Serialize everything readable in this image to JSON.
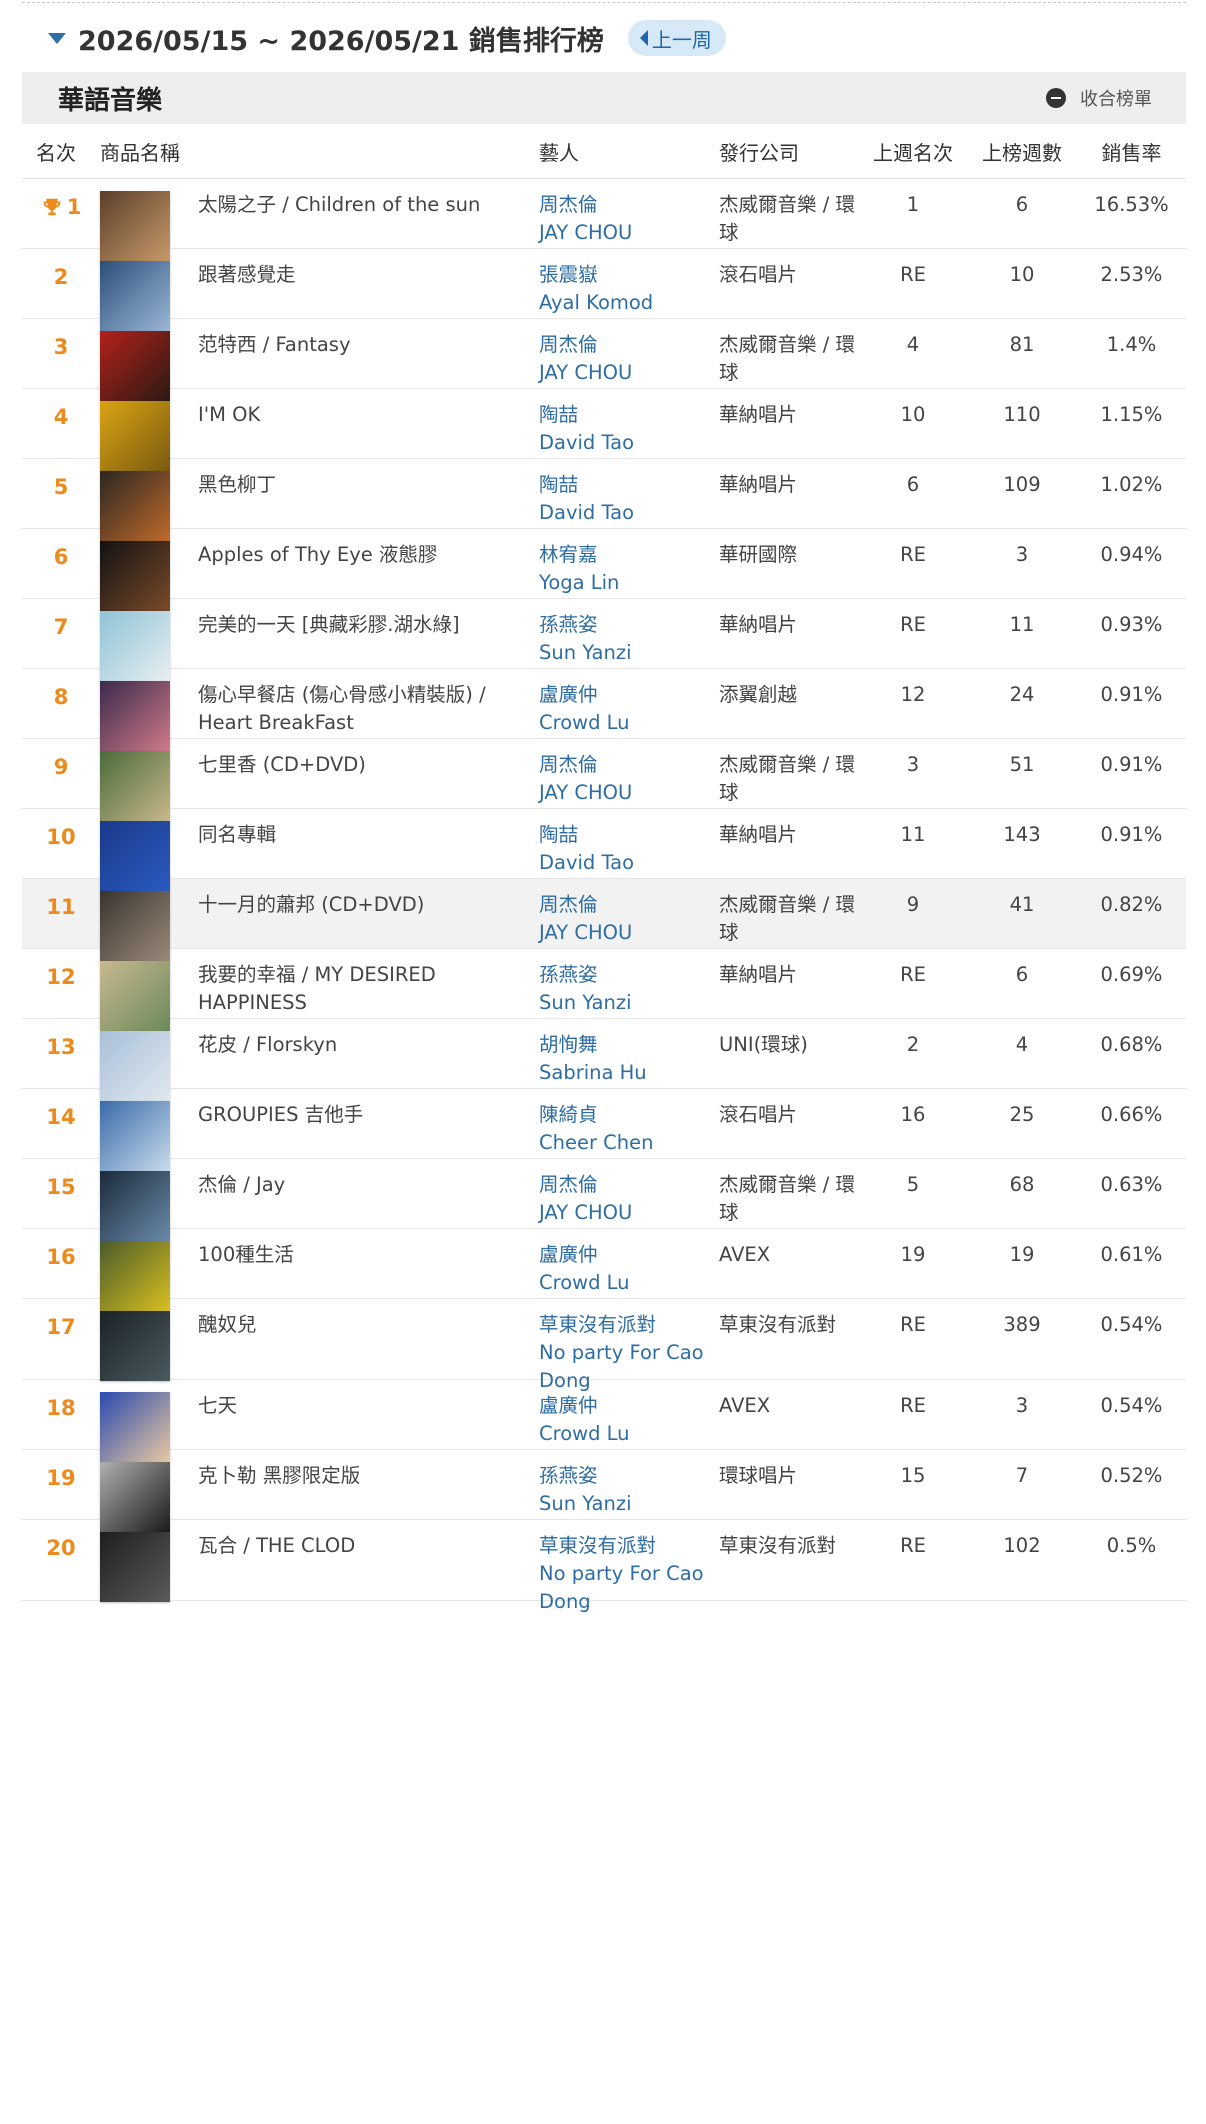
{
  "week": {
    "title": "2026/05/15 ~ 2026/05/21 銷售排行榜",
    "prev_label": "上一周"
  },
  "section": {
    "title": "華語音樂",
    "collapse_label": "收合榜單"
  },
  "columns": {
    "rank": "名次",
    "product": "商品名稱",
    "artist": "藝人",
    "label": "發行公司",
    "last_week": "上週名次",
    "weeks_on_chart": "上榜週數",
    "sales_rate": "銷售率"
  },
  "colors": {
    "accent_rank": "#ec8a1c",
    "link_blue": "#2e6da4"
  },
  "rows": [
    {
      "rank": "1",
      "trophy": true,
      "title": "太陽之子 / Children of the sun",
      "artist_zh": "周杰倫",
      "artist_en": "JAY CHOU",
      "label": "杰威爾音樂 / 環球",
      "last": "1",
      "weeks": "6",
      "rate": "16.53%",
      "cover": [
        "#5a3e2a",
        "#c89a6a"
      ]
    },
    {
      "rank": "2",
      "title": "跟著感覺走",
      "artist_zh": "張震嶽",
      "artist_en": "Ayal Komod",
      "label": "滾石唱片",
      "last": "RE",
      "weeks": "10",
      "rate": "2.53%",
      "cover": [
        "#2a4f7a",
        "#9bb7d6"
      ]
    },
    {
      "rank": "3",
      "title": "范特西 / Fantasy",
      "artist_zh": "周杰倫",
      "artist_en": "JAY CHOU",
      "label": "杰威爾音樂 / 環球",
      "last": "4",
      "weeks": "81",
      "rate": "1.4%",
      "cover": [
        "#b3201a",
        "#2a1a14"
      ]
    },
    {
      "rank": "4",
      "title": "I'M OK",
      "artist_zh": "陶喆",
      "artist_en": "David Tao",
      "label": "華納唱片",
      "last": "10",
      "weeks": "110",
      "rate": "1.15%",
      "cover": [
        "#d9a413",
        "#7a5a10"
      ]
    },
    {
      "rank": "5",
      "title": "黑色柳丁",
      "artist_zh": "陶喆",
      "artist_en": "David Tao",
      "label": "華納唱片",
      "last": "6",
      "weeks": "109",
      "rate": "1.02%",
      "cover": [
        "#2a2622",
        "#c06a2a"
      ]
    },
    {
      "rank": "6",
      "title": "Apples of Thy Eye 液態膠",
      "artist_zh": "林宥嘉",
      "artist_en": "Yoga Lin",
      "label": "華研國際",
      "last": "RE",
      "weeks": "3",
      "rate": "0.94%",
      "cover": [
        "#111111",
        "#7a4a2a"
      ]
    },
    {
      "rank": "7",
      "title": "完美的一天 [典藏彩膠.湖水綠]",
      "artist_zh": "孫燕姿",
      "artist_en": "Sun Yanzi",
      "label": "華納唱片",
      "last": "RE",
      "weeks": "11",
      "rate": "0.93%",
      "cover": [
        "#8ec3d6",
        "#e8eef0"
      ]
    },
    {
      "rank": "8",
      "title": "傷心早餐店 (傷心骨感小精裝版) / Heart BreakFast",
      "artist_zh": "盧廣仲",
      "artist_en": "Crowd Lu",
      "label": "添翼創越",
      "last": "12",
      "weeks": "24",
      "rate": "0.91%",
      "cover": [
        "#3a2a4a",
        "#d07a8a"
      ]
    },
    {
      "rank": "9",
      "title": "七里香 (CD+DVD)",
      "artist_zh": "周杰倫",
      "artist_en": "JAY CHOU",
      "label": "杰威爾音樂 / 環球",
      "last": "3",
      "weeks": "51",
      "rate": "0.91%",
      "cover": [
        "#4a6a3a",
        "#c8b88a"
      ]
    },
    {
      "rank": "10",
      "title": "同名專輯",
      "artist_zh": "陶喆",
      "artist_en": "David Tao",
      "label": "華納唱片",
      "last": "11",
      "weeks": "143",
      "rate": "0.91%",
      "cover": [
        "#1a3a8a",
        "#2a5ac0"
      ]
    },
    {
      "rank": "11",
      "highlight": true,
      "title": "十一月的蕭邦 (CD+DVD)",
      "artist_zh": "周杰倫",
      "artist_en": "JAY CHOU",
      "label": "杰威爾音樂 / 環球",
      "last": "9",
      "weeks": "41",
      "rate": "0.82%",
      "cover": [
        "#3a342e",
        "#9a8a7a"
      ]
    },
    {
      "rank": "12",
      "title": "我要的幸福 / MY DESIRED HAPPINESS",
      "artist_zh": "孫燕姿",
      "artist_en": "Sun Yanzi",
      "label": "華納唱片",
      "last": "RE",
      "weeks": "6",
      "rate": "0.69%",
      "cover": [
        "#c8b890",
        "#6a8a5a"
      ]
    },
    {
      "rank": "13",
      "title": "花皮 / Florskyn",
      "artist_zh": "胡恂舞",
      "artist_en": "Sabrina Hu",
      "label": "UNI(環球)",
      "last": "2",
      "weeks": "4",
      "rate": "0.68%",
      "cover": [
        "#a8c0d8",
        "#e0e8f0"
      ]
    },
    {
      "rank": "14",
      "title": "GROUPIES 吉他手",
      "artist_zh": "陳綺貞",
      "artist_en": "Cheer Chen",
      "label": "滾石唱片",
      "last": "16",
      "weeks": "25",
      "rate": "0.66%",
      "cover": [
        "#3a6aa8",
        "#c8dcec"
      ]
    },
    {
      "rank": "15",
      "title": "杰倫 / Jay",
      "artist_zh": "周杰倫",
      "artist_en": "JAY CHOU",
      "label": "杰威爾音樂 / 環球",
      "last": "5",
      "weeks": "68",
      "rate": "0.63%",
      "cover": [
        "#1a2a3a",
        "#6a8aaa"
      ]
    },
    {
      "rank": "16",
      "title": "100種生活",
      "artist_zh": "盧廣仲",
      "artist_en": "Crowd Lu",
      "label": "AVEX",
      "last": "19",
      "weeks": "19",
      "rate": "0.61%",
      "cover": [
        "#4a5a2a",
        "#d8c020"
      ]
    },
    {
      "rank": "17",
      "title": "醜奴兒",
      "artist_zh": "草東沒有派對",
      "artist_en": "No party For Cao Dong",
      "label": "草東沒有派對",
      "last": "RE",
      "weeks": "389",
      "rate": "0.54%",
      "cover": [
        "#1a2226",
        "#4a5a60"
      ]
    },
    {
      "rank": "18",
      "title": "七天",
      "artist_zh": "盧廣仲",
      "artist_en": "Crowd Lu",
      "label": "AVEX",
      "last": "RE",
      "weeks": "3",
      "rate": "0.54%",
      "cover": [
        "#2a4ab0",
        "#e8c8a0"
      ]
    },
    {
      "rank": "19",
      "title": "克卜勒 黑膠限定版",
      "artist_zh": "孫燕姿",
      "artist_en": "Sun Yanzi",
      "label": "環球唱片",
      "last": "15",
      "weeks": "7",
      "rate": "0.52%",
      "cover": [
        "#b0b0b0",
        "#1a1a1a"
      ]
    },
    {
      "rank": "20",
      "title": "瓦合 / THE CLOD",
      "artist_zh": "草東沒有派對",
      "artist_en": "No party For Cao Dong",
      "label": "草東沒有派對",
      "last": "RE",
      "weeks": "102",
      "rate": "0.5%",
      "cover": [
        "#1e1e1e",
        "#5a5a5a"
      ]
    }
  ]
}
